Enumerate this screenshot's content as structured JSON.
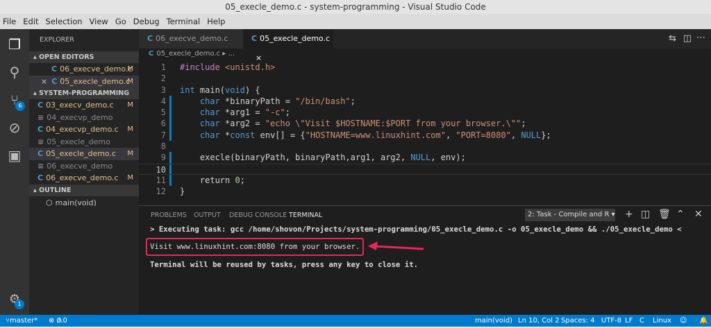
{
  "window": {
    "title": "05_execle_demo.c - system-programming - Visual Studio Code"
  },
  "menu": [
    "File",
    "Edit",
    "Selection",
    "View",
    "Go",
    "Debug",
    "Terminal",
    "Help"
  ],
  "activity": {
    "scm_badge": "6",
    "settings_badge": "1"
  },
  "sidebar": {
    "title": "EXPLORER",
    "open_editors_header": "OPEN EDITORS",
    "open_editors": [
      {
        "name": "06_execve_demo.c",
        "badge": "M"
      },
      {
        "name": "05_execle_demo.c",
        "badge": "M",
        "close": "×"
      }
    ],
    "project_header": "SYSTEM-PROGRAMMING",
    "files": [
      {
        "name": "03_execv_demo.c",
        "badge": "M",
        "type": "c"
      },
      {
        "name": "04_execvp_demo",
        "badge": "",
        "type": "bin"
      },
      {
        "name": "04_execvp_demo.c",
        "badge": "M",
        "type": "c"
      },
      {
        "name": "05_execle_demo",
        "badge": "",
        "type": "bin"
      },
      {
        "name": "05_execle_demo.c",
        "badge": "M",
        "type": "c"
      },
      {
        "name": "06_execve_demo",
        "badge": "",
        "type": "bin"
      },
      {
        "name": "06_execve_demo.c",
        "badge": "M",
        "type": "c"
      }
    ],
    "outline_header": "OUTLINE",
    "outline_item": "main(void)"
  },
  "tabs": [
    {
      "label": "06_execve_demo.c"
    },
    {
      "label": "05_execle_demo.c",
      "close": "×"
    }
  ],
  "breadcrumb": {
    "file": "05_execle_demo.c",
    "rest": "▸ ..."
  },
  "code": [
    [
      [
        "#include ",
        "pp"
      ],
      [
        "<unistd.h>",
        "str"
      ]
    ],
    [],
    [
      [
        "int ",
        "kw"
      ],
      [
        "main(",
        "t"
      ],
      [
        "void",
        "kw"
      ],
      [
        ") {",
        "t"
      ]
    ],
    [
      [
        "    char ",
        "kw"
      ],
      [
        "*binaryPath = ",
        "t"
      ],
      [
        "\"/bin/bash\"",
        "str"
      ],
      [
        ";",
        "t"
      ]
    ],
    [
      [
        "    char ",
        "kw"
      ],
      [
        "*arg1 = ",
        "t"
      ],
      [
        "\"-c\"",
        "str"
      ],
      [
        ";",
        "t"
      ]
    ],
    [
      [
        "    char ",
        "kw"
      ],
      [
        "*arg2 = ",
        "t"
      ],
      [
        "\"echo \\\"Visit $HOSTNAME:$PORT from your browser.\\\"\"",
        "str"
      ],
      [
        ";",
        "t"
      ]
    ],
    [
      [
        "    char ",
        "kw"
      ],
      [
        "*",
        "t"
      ],
      [
        "const ",
        "kw"
      ],
      [
        "env[] = {",
        "t"
      ],
      [
        "\"HOSTNAME=www.linuxhint.com\"",
        "str"
      ],
      [
        ", ",
        "t"
      ],
      [
        "\"PORT=8080\"",
        "str"
      ],
      [
        ", ",
        "t"
      ],
      [
        "NULL",
        "kw"
      ],
      [
        "};",
        "t"
      ]
    ],
    [],
    [
      [
        "    execle(binaryPath, binaryPath,arg1, arg2, ",
        "t"
      ],
      [
        "NULL",
        "kw"
      ],
      [
        ", env);",
        "t"
      ]
    ],
    [],
    [
      [
        "    return ",
        "t"
      ],
      [
        "0",
        "num"
      ],
      [
        ";",
        "t"
      ]
    ],
    [
      [
        "}",
        "t"
      ]
    ]
  ],
  "panel": {
    "tabs": [
      "PROBLEMS",
      "OUTPUT",
      "DEBUG CONSOLE",
      "TERMINAL"
    ],
    "terminal_select": "2: Task - Compile and R ▾",
    "lines": [
      "> Executing task: gcc /home/shovon/Projects/system-programming/05_execle_demo.c -o 05_execle_demo && ./05_execle_demo <",
      "Visit www.linuxhint.com:8080 from your browser.",
      "Terminal will be reused by tasks, press any key to close it."
    ]
  },
  "status": {
    "branch": "master*",
    "errors": "0",
    "warnings": "0",
    "scope": "main(void)",
    "position": "Ln 10, Col 2",
    "spaces": "Spaces: 4",
    "encoding": "UTF-8",
    "eol": "LF",
    "language": "C",
    "platform": "Linux"
  },
  "colors": {
    "accent": "#007acc",
    "annotation": "#e8265b"
  }
}
